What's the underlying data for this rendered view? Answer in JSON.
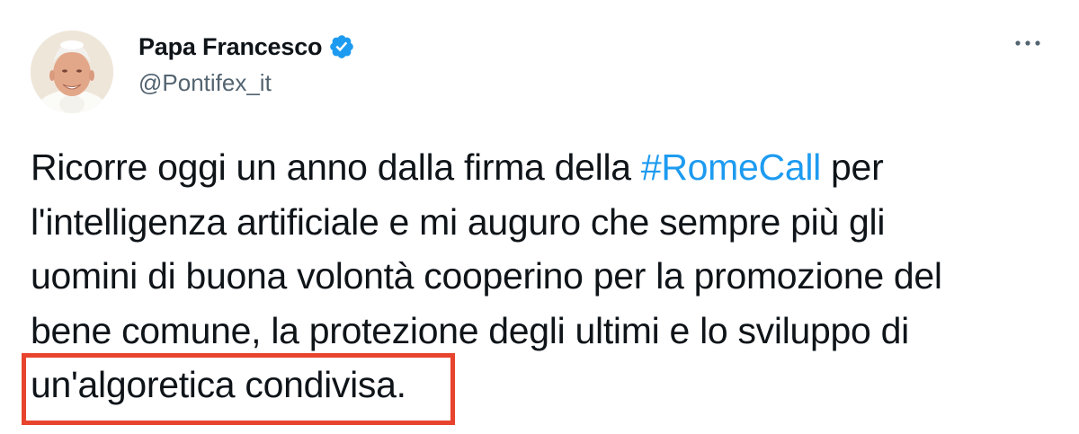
{
  "author": {
    "display_name": "Papa Francesco",
    "handle": "@Pontifex_it",
    "verified": true,
    "avatar": "pope-francis-portrait"
  },
  "menu": {
    "icon": "more-horizontal-icon"
  },
  "tweet": {
    "lines": [
      {
        "before": "Ricorre oggi un anno dalla firma della ",
        "hashtag": "#RomeCall",
        "after": " per"
      },
      {
        "text": "l'intelligenza artificiale e mi auguro che sempre più gli"
      },
      {
        "text": "uomini di buona volontà cooperino per la promozione del"
      },
      {
        "text": "bene comune, la protezione degli ultimi e lo sviluppo di"
      },
      {
        "text": "un'algoretica condivisa."
      }
    ]
  },
  "colors": {
    "hashtag": "#1d9bf0",
    "verified_badge": "#1d9bf0",
    "highlight_border": "#e8442d",
    "handle": "#536471",
    "text": "#0f1419"
  }
}
